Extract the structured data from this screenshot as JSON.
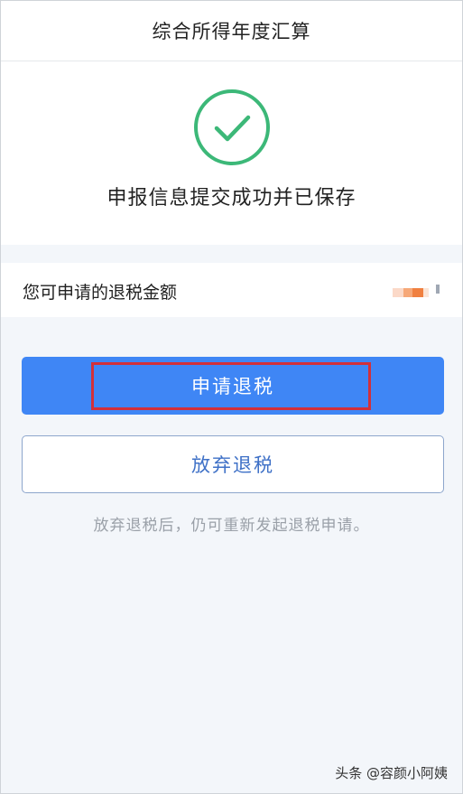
{
  "header": {
    "title": "综合所得年度汇算"
  },
  "success": {
    "icon": "check-circle-icon",
    "message": "申报信息提交成功并已保存",
    "color": "#3cb878"
  },
  "refund": {
    "label": "您可申请的退税金额"
  },
  "actions": {
    "apply_label": "申请退税",
    "abandon_label": "放弃退税",
    "hint": "放弃退税后，仍可重新发起退税申请。",
    "apply_color": "#3f86f5",
    "highlight_color": "#d2303a"
  },
  "watermark": {
    "text": "头条 @容颜小阿姨"
  }
}
